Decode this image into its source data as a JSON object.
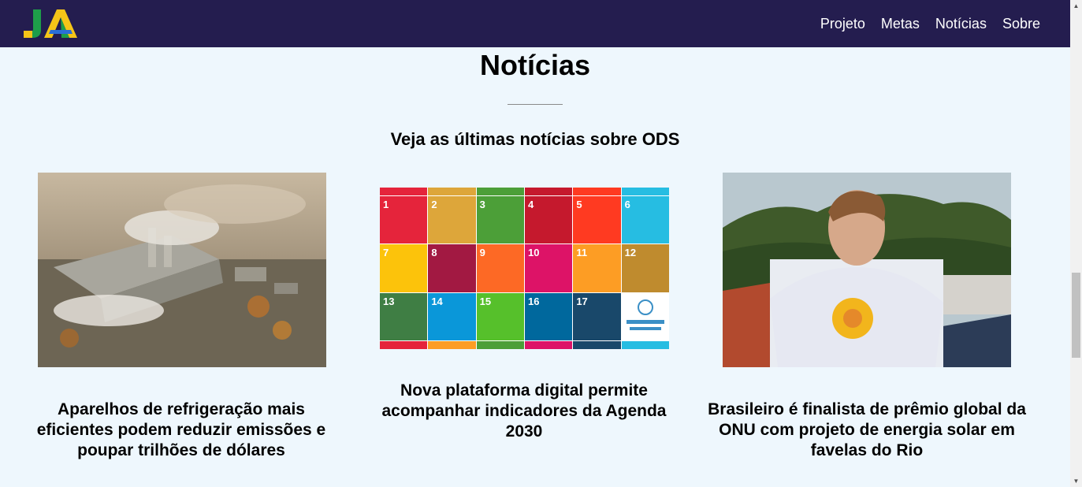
{
  "brand": {
    "logo_text": "JA"
  },
  "nav": {
    "items": [
      {
        "label": "Projeto"
      },
      {
        "label": "Metas"
      },
      {
        "label": "Notícias"
      },
      {
        "label": "Sobre"
      }
    ]
  },
  "section": {
    "title": "Notícias",
    "subtitle": "Veja as últimas notícias sobre ODS"
  },
  "cards": [
    {
      "title": "Aparelhos de refrigeração mais eficientes podem reduzir emissões e poupar trilhões de dólares"
    },
    {
      "title": "Nova plataforma digital permite acompanhar indicadores da Agenda 2030"
    },
    {
      "title": "Brasileiro é finalista de prêmio global da ONU com projeto de energia solar em favelas do Rio"
    }
  ],
  "sdg": {
    "tiles": [
      {
        "num": "1",
        "color": "#e5243b"
      },
      {
        "num": "2",
        "color": "#dda63a"
      },
      {
        "num": "3",
        "color": "#4c9f38"
      },
      {
        "num": "4",
        "color": "#c5192d"
      },
      {
        "num": "5",
        "color": "#ff3a21"
      },
      {
        "num": "6",
        "color": "#26bde2"
      },
      {
        "num": "7",
        "color": "#fcc30b"
      },
      {
        "num": "8",
        "color": "#a21942"
      },
      {
        "num": "9",
        "color": "#fd6925"
      },
      {
        "num": "10",
        "color": "#dd1367"
      },
      {
        "num": "11",
        "color": "#fd9d24"
      },
      {
        "num": "12",
        "color": "#bf8b2e"
      },
      {
        "num": "13",
        "color": "#3f7e44"
      },
      {
        "num": "14",
        "color": "#0a97d9"
      },
      {
        "num": "15",
        "color": "#56c02b"
      },
      {
        "num": "16",
        "color": "#00689d"
      },
      {
        "num": "17",
        "color": "#19486a"
      },
      {
        "num": "",
        "color": "#ffffff"
      }
    ]
  },
  "colors": {
    "navbar": "#241d4f",
    "page_bg": "#eef7fd"
  }
}
